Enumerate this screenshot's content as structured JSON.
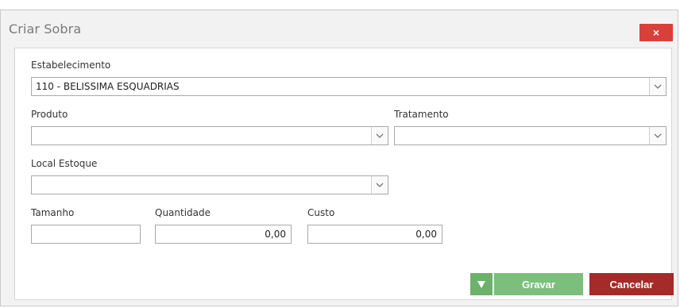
{
  "dialog": {
    "title": "Criar Sobra",
    "close_label": "×"
  },
  "form": {
    "estabelecimento": {
      "label": "Estabelecimento",
      "value": "110 - BELISSIMA ESQUADRIAS"
    },
    "produto": {
      "label": "Produto",
      "value": ""
    },
    "tratamento": {
      "label": "Tratamento",
      "value": ""
    },
    "local_estoque": {
      "label": "Local Estoque",
      "value": ""
    },
    "tamanho": {
      "label": "Tamanho",
      "value": ""
    },
    "quantidade": {
      "label": "Quantidade",
      "value": "0,00"
    },
    "custo": {
      "label": "Custo",
      "value": "0,00"
    }
  },
  "actions": {
    "save_label": "Gravar",
    "cancel_label": "Cancelar"
  },
  "colors": {
    "close": "#d9403a",
    "save": "#7cbf7c",
    "save_arrow": "#6bb36b",
    "cancel": "#a52a2a"
  }
}
